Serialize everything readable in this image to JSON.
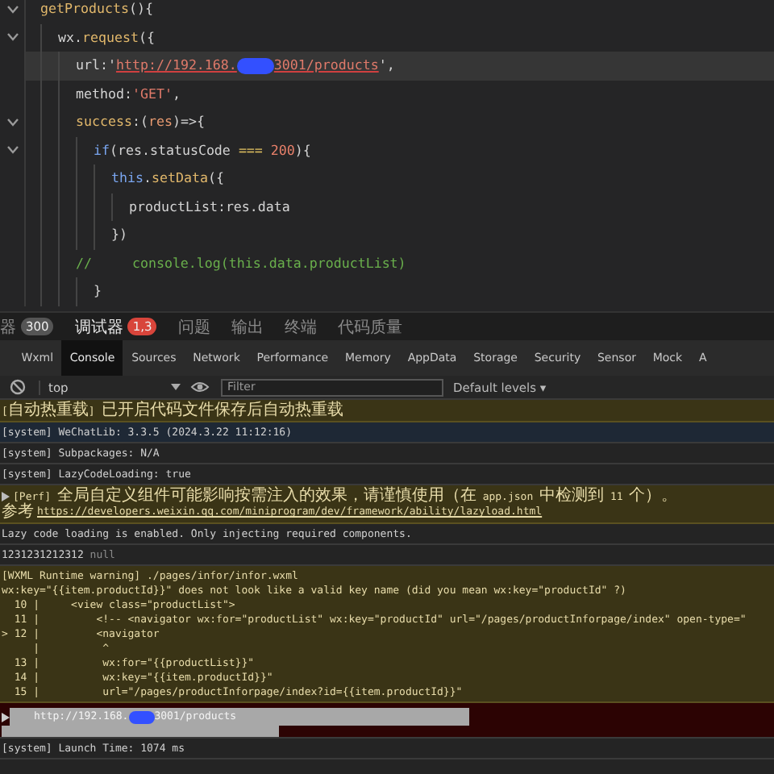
{
  "editor": {
    "lines": [
      {
        "fold": true,
        "selected": false,
        "segments": [
          {
            "kind": "fn",
            "text": "getProducts"
          },
          {
            "kind": "plain",
            "text": "(){"
          }
        ]
      },
      {
        "fold": true,
        "selected": false,
        "segments": [
          {
            "kind": "plain",
            "text": "  wx"
          },
          {
            "kind": "plain",
            "text": "."
          },
          {
            "kind": "fn",
            "text": "request"
          },
          {
            "kind": "plain",
            "text": "({"
          }
        ]
      },
      {
        "fold": false,
        "selected": true,
        "segments": [
          {
            "kind": "plain",
            "text": "    url:'"
          },
          {
            "kind": "link",
            "text": "http://192.168."
          },
          {
            "kind": "redaction"
          },
          {
            "kind": "link",
            "text": "3001/products"
          },
          {
            "kind": "plain",
            "text": "',"
          }
        ]
      },
      {
        "fold": false,
        "selected": false,
        "segments": [
          {
            "kind": "plain",
            "text": "    method:"
          },
          {
            "kind": "str",
            "text": "'GET'"
          },
          {
            "kind": "plain",
            "text": ","
          }
        ]
      },
      {
        "fold": true,
        "selected": false,
        "segments": [
          {
            "kind": "fn",
            "text": "    success"
          },
          {
            "kind": "plain",
            "text": ":("
          },
          {
            "kind": "param",
            "text": "res"
          },
          {
            "kind": "plain",
            "text": ")=>{"
          }
        ]
      },
      {
        "fold": true,
        "selected": false,
        "segments": [
          {
            "kind": "kw",
            "text": "      if"
          },
          {
            "kind": "plain",
            "text": "(res.statusCode "
          },
          {
            "kind": "op",
            "text": "==="
          },
          {
            "kind": "num",
            "text": " 200"
          },
          {
            "kind": "plain",
            "text": "){"
          }
        ]
      },
      {
        "fold": false,
        "selected": false,
        "segments": [
          {
            "kind": "kw",
            "text": "        this"
          },
          {
            "kind": "plain",
            "text": "."
          },
          {
            "kind": "fn",
            "text": "setData"
          },
          {
            "kind": "plain",
            "text": "({"
          }
        ]
      },
      {
        "fold": false,
        "selected": false,
        "segments": [
          {
            "kind": "plain",
            "text": "          productList:res.data"
          }
        ]
      },
      {
        "fold": false,
        "selected": false,
        "segments": [
          {
            "kind": "plain",
            "text": "        })"
          }
        ]
      },
      {
        "fold": false,
        "selected": false,
        "segments": [
          {
            "kind": "cmt",
            "text": "    //     console.log(this.data.productList)"
          }
        ]
      },
      {
        "fold": false,
        "selected": false,
        "segments": [
          {
            "kind": "plain",
            "text": "      }"
          }
        ]
      }
    ]
  },
  "panel_tabs": [
    {
      "label": "器",
      "badge": {
        "text": "300",
        "kind": "neutral"
      },
      "selected": false
    },
    {
      "label": "调试器",
      "badge": {
        "text": "1,3",
        "kind": "error"
      },
      "selected": true
    },
    {
      "label": "问题",
      "selected": false
    },
    {
      "label": "输出",
      "selected": false
    },
    {
      "label": "终端",
      "selected": false
    },
    {
      "label": "代码质量",
      "selected": false
    }
  ],
  "devtools_tabs": [
    {
      "label": "Wxml",
      "selected": false
    },
    {
      "label": "Console",
      "selected": true
    },
    {
      "label": "Sources",
      "selected": false
    },
    {
      "label": "Network",
      "selected": false
    },
    {
      "label": "Performance",
      "selected": false
    },
    {
      "label": "Memory",
      "selected": false
    },
    {
      "label": "AppData",
      "selected": false
    },
    {
      "label": "Storage",
      "selected": false
    },
    {
      "label": "Security",
      "selected": false
    },
    {
      "label": "Sensor",
      "selected": false
    },
    {
      "label": "Mock",
      "selected": false
    },
    {
      "label": "A",
      "selected": false
    }
  ],
  "console_toolbar": {
    "context": "top",
    "filter": {
      "placeholder": "Filter"
    },
    "levels": "Default levels ▾"
  },
  "messages": [
    {
      "kind": "warning",
      "selected": false,
      "text": "[自动热重载] 已开启代码文件保存后自动热重载"
    },
    {
      "kind": "info",
      "selected": false,
      "text": "[system] WeChatLib: 3.3.5 (2024.3.22 11:12:16)"
    },
    {
      "kind": "log",
      "selected": false,
      "text": "[system] Subpackages: N/A"
    },
    {
      "kind": "log",
      "selected": false,
      "text": "[system] LazyCodeLoading: true"
    },
    {
      "kind": "perf",
      "selected": false,
      "text": "[Perf] 全局自定义组件可能影响按需注入的效果，请谨慎使用（在 app.json 中检测到 11 个）。",
      "ref_label": "参考",
      "link": "https://developers.weixin.qq.com/miniprogram/dev/framework/ability/lazyload.html"
    },
    {
      "kind": "log",
      "selected": false,
      "text": "Lazy code loading is enabled. Only injecting required components."
    },
    {
      "kind": "value",
      "selected": false,
      "text": "1231231212312",
      "value": "null"
    },
    {
      "kind": "wxml",
      "selected": false,
      "text": "[WXML Runtime warning] ./pages/infor/infor.wxml",
      "detail": "wx:key=\"{{item.productId}}\" does not look like a valid key name (did you mean wx:key=\"productId\" ?)",
      "frame": [
        "  10 |     <view class=\"productList\">",
        "  11 |         <!-- <navigator wx:for=\"productList\" wx:key=\"productId\" url=\"/pages/productInforpage/index\" open-type=\"",
        "> 12 |         <navigator",
        "     |          ^",
        "  13 |          wx:for=\"{{productList}}\"",
        "  14 |          wx:key=\"{{item.productId}}\"",
        "  15 |          url=\"/pages/productInforpage/index?id={{item.productId}}\""
      ]
    },
    {
      "kind": "error",
      "selected": true,
      "before": "http://192.168.",
      "after": "3001/products"
    },
    {
      "kind": "log",
      "selected": false,
      "text": "[system] Launch Time: 1074 ms"
    }
  ]
}
